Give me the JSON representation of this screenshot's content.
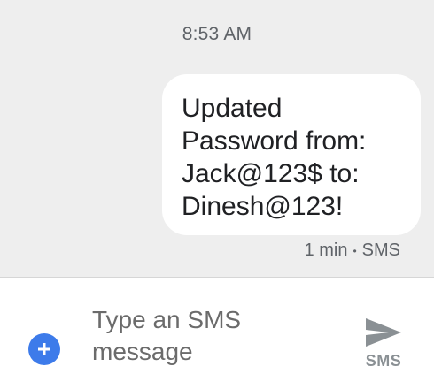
{
  "conversation": {
    "timestamp": "8:53 AM",
    "message": {
      "text": "Updated\nPassword from:\nJack@123$ to:\nDinesh@123!",
      "age": "1 min",
      "separator": "•",
      "channel": "SMS"
    }
  },
  "composer": {
    "placeholder": "Type an SMS\nmessage",
    "send_label": "SMS",
    "add_icon": "plus-circle-icon",
    "send_icon": "send-arrow-icon"
  },
  "colors": {
    "background": "#eeeeee",
    "bubble": "#ffffff",
    "accent": "#3d7bea",
    "send_icon": "#8a9094"
  }
}
